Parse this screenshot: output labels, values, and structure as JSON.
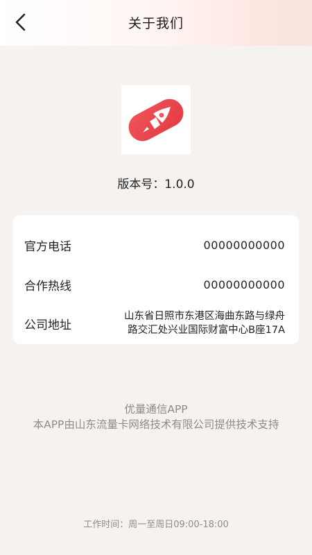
{
  "header": {
    "title": "关于我们",
    "back_icon": "chevron-left-icon"
  },
  "app": {
    "logo_icon": "rocket-icon",
    "brand_color": "#e8424a",
    "version_label": "版本号：",
    "version_number": "1.0.0"
  },
  "contact": {
    "items": [
      {
        "label": "官方电话",
        "value": "00000000000"
      },
      {
        "label": "合作热线",
        "value": "00000000000"
      },
      {
        "label": "公司地址",
        "value_line1": "山东省日照市东港区海曲东路与绿舟",
        "value_line2": "路交汇处兴业国际财富中心B座17A"
      }
    ]
  },
  "footer": {
    "app_name": "优量通信APP",
    "support_text": "本APP由山东流量卡网络技术有限公司提供技术支持",
    "work_time": "工作时间：周一至周日09:00-18:00"
  }
}
